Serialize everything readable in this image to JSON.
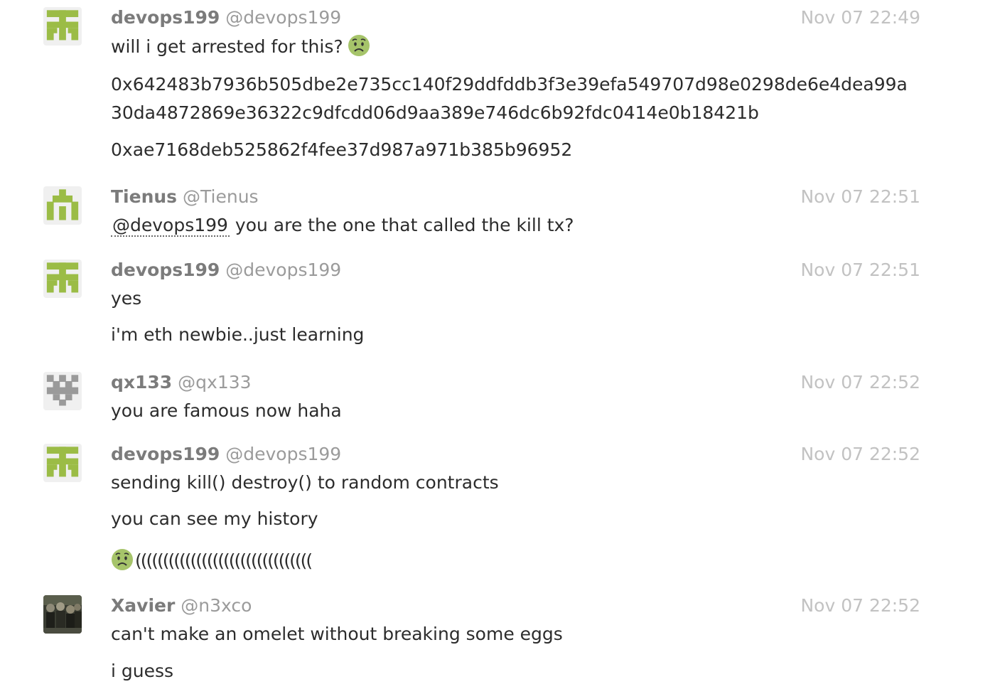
{
  "messages": [
    {
      "display_name": "devops199",
      "username": "@devops199",
      "timestamp": "Nov 07 22:49",
      "avatar": "identicon-green-devops199",
      "lines": [
        "will i get arrested for this?",
        "0x642483b7936b505dbe2e735cc140f29ddfddb3f3e39efa549707d98e0298de6e4dea99a30da4872869e36322c9dfcdd06d9aa389e746dc6b92fdc0414e0b18421b",
        "0xae7168deb525862f4fee37d987a971b385b96952"
      ],
      "emoji": "worried-face-icon"
    },
    {
      "display_name": "Tienus",
      "username": "@Tienus",
      "timestamp": "Nov 07 22:51",
      "avatar": "identicon-green-tienus",
      "mention": "@devops199",
      "lines": [
        "you are the one that called the kill tx?"
      ]
    },
    {
      "display_name": "devops199",
      "username": "@devops199",
      "timestamp": "Nov 07 22:51",
      "avatar": "identicon-green-devops199",
      "lines": [
        "yes",
        "i'm eth newbie..just learning"
      ]
    },
    {
      "display_name": "qx133",
      "username": "@qx133",
      "timestamp": "Nov 07 22:52",
      "avatar": "identicon-gray-qx133",
      "lines": [
        "you are famous now haha"
      ]
    },
    {
      "display_name": "devops199",
      "username": "@devops199",
      "timestamp": "Nov 07 22:52",
      "avatar": "identicon-green-devops199",
      "lines": [
        "sending kill() destroy() to random contracts",
        "you can see my history",
        "(((((((((((((((((((((((((((((((("
      ],
      "emoji": "worried-face-icon"
    },
    {
      "display_name": "Xavier",
      "username": "@n3xco",
      "timestamp": "Nov 07 22:52",
      "avatar": "photo-avatar-xavier",
      "lines": [
        "can't make an omelet without breaking some eggs",
        "i guess"
      ]
    }
  ],
  "colors": {
    "identicon_green": "#9bbc46",
    "identicon_gray": "#9a9a9a",
    "display_name": "#7b7b7b",
    "username": "#9b9b9b",
    "timestamp": "#c2c2c2",
    "text": "#2c2c2c",
    "emoji_face": "#a6c46a"
  }
}
